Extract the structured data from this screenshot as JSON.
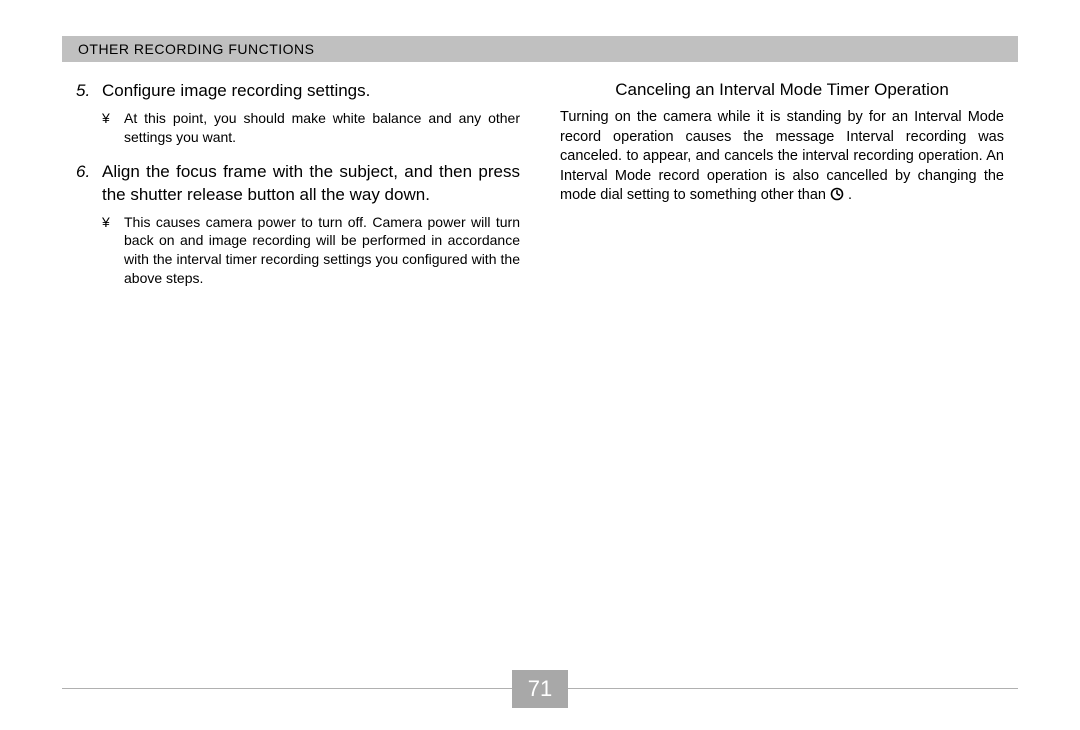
{
  "header": {
    "title": "OTHER RECORDING FUNCTIONS"
  },
  "left_column": {
    "steps": [
      {
        "num": "5.",
        "text": "Configure image recording settings.",
        "bullet_mark": "¥",
        "bullet": "At this point, you should make white balance and any other settings you want."
      },
      {
        "num": "6.",
        "text": "Align the focus frame with the subject, and then press the shutter release button all the way down.",
        "bullet_mark": "¥",
        "bullet": "This causes camera power to turn off. Camera power will turn back on and image recording will be performed in accordance with the interval timer recording settings you configured with the above steps."
      }
    ]
  },
  "right_column": {
    "subheading": "Canceling an Interval Mode Timer Operation",
    "para_before": "Turning on the camera while it is standing by for an Interval Mode record operation causes the message  Interval recording was canceled.  to appear, and cancels the interval recording operation. An Interval Mode record operation is also cancelled by changing the mode dial setting to something other than ",
    "para_after": " .",
    "icon_name": "interval-mode-icon"
  },
  "page_number": "71"
}
